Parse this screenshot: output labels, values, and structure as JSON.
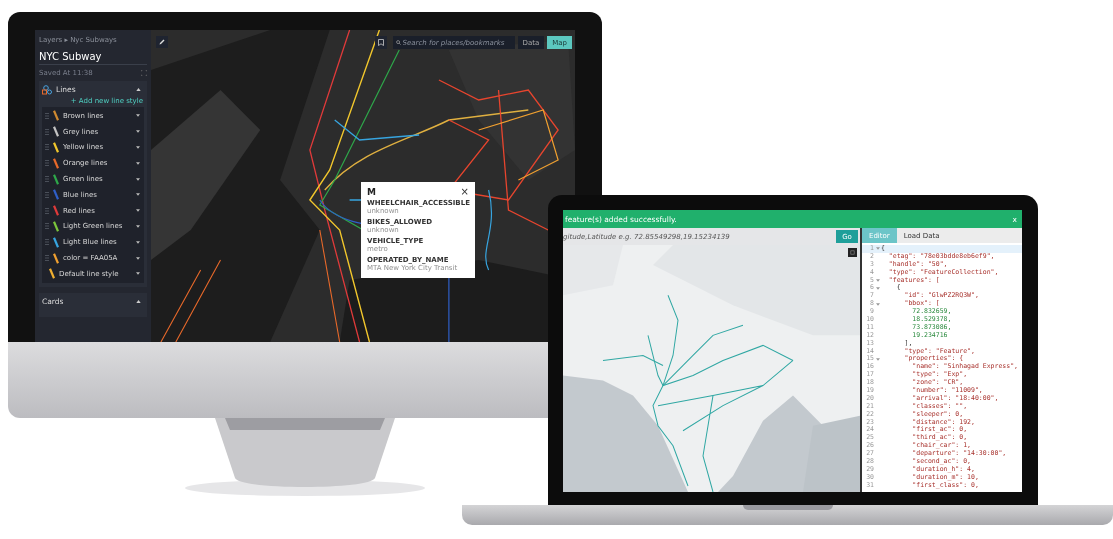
{
  "monitor": {
    "sidebar": {
      "breadcrumb": "Layers ▸ Nyc Subways",
      "title": "NYC Subway",
      "saved": "Saved At 11:38",
      "lines_panel": {
        "title": "Lines",
        "expanded": true,
        "add_label": "+ Add new line style",
        "items": [
          {
            "label": "Brown lines",
            "color": "#d08a30",
            "kind": "style"
          },
          {
            "label": "Grey lines",
            "color": "#c4c4c4",
            "kind": "style"
          },
          {
            "label": "Yellow lines",
            "color": "#f2c72c",
            "kind": "style"
          },
          {
            "label": "Orange lines",
            "color": "#e8692a",
            "kind": "style"
          },
          {
            "label": "Green lines",
            "color": "#2ea84a",
            "kind": "style"
          },
          {
            "label": "Blue lines",
            "color": "#2f5fc8",
            "kind": "style"
          },
          {
            "label": "Red lines",
            "color": "#e03a3a",
            "kind": "style"
          },
          {
            "label": "Light Green lines",
            "color": "#7cc63c",
            "kind": "style"
          },
          {
            "label": "Light Blue lines",
            "color": "#37a5e0",
            "kind": "style"
          },
          {
            "label": "color = FAA05A",
            "color": "#f0a030",
            "kind": "style"
          },
          {
            "label": "Default line style",
            "color": "#f0b030",
            "kind": "default"
          }
        ]
      },
      "cards_panel": {
        "title": "Cards",
        "expanded": true
      }
    },
    "map": {
      "search": {
        "placeholder": "Search for places/bookmarks"
      },
      "view_tabs": [
        {
          "label": "Data",
          "selected": false
        },
        {
          "label": "Map",
          "selected": true
        }
      ],
      "popup": {
        "title": "M",
        "close": "×",
        "properties": [
          {
            "key": "WHEELCHAIR_ACCESSIBLE",
            "value": "unknown"
          },
          {
            "key": "BIKES_ALLOWED",
            "value": "unknown"
          },
          {
            "key": "VEHICLE_TYPE",
            "value": "metro"
          },
          {
            "key": "OPERATED_BY_NAME",
            "value": "MTA New York City Transit"
          }
        ]
      }
    }
  },
  "laptop": {
    "notification": {
      "message": "feature(s) added successfully.",
      "close": "x"
    },
    "search": {
      "placeholder": "gitude,Latitude e.g. 72.85549298,19.15234139",
      "button": "Go"
    },
    "editor_tabs": [
      {
        "label": "Editor",
        "selected": true
      },
      {
        "label": "Load Data",
        "selected": false
      }
    ],
    "code_lines": [
      {
        "number": "1",
        "code": "{",
        "foldable": true,
        "active": true,
        "kind": "punct"
      },
      {
        "number": "2",
        "code": "  \"etag\": \"78e03bdde8eb6ef9\",",
        "foldable": false,
        "active": false,
        "kind": "string"
      },
      {
        "number": "3",
        "code": "  \"handle\": \"50\",",
        "foldable": false,
        "active": false,
        "kind": "string"
      },
      {
        "number": "4",
        "code": "  \"type\": \"FeatureCollection\",",
        "foldable": false,
        "active": false,
        "kind": "string"
      },
      {
        "number": "5",
        "code": "  \"features\": [",
        "foldable": true,
        "active": false,
        "kind": "string"
      },
      {
        "number": "6",
        "code": "    {",
        "foldable": true,
        "active": false,
        "kind": "punct"
      },
      {
        "number": "7",
        "code": "      \"id\": \"GlwPZ2RQ3W\",",
        "foldable": false,
        "active": false,
        "kind": "string"
      },
      {
        "number": "8",
        "code": "      \"bbox\": [",
        "foldable": true,
        "active": false,
        "kind": "string"
      },
      {
        "number": "9",
        "code": "        72.832659,",
        "foldable": false,
        "active": false,
        "kind": "number"
      },
      {
        "number": "10",
        "code": "        18.529378,",
        "foldable": false,
        "active": false,
        "kind": "number"
      },
      {
        "number": "11",
        "code": "        73.873086,",
        "foldable": false,
        "active": false,
        "kind": "number"
      },
      {
        "number": "12",
        "code": "        19.234716",
        "foldable": false,
        "active": false,
        "kind": "number"
      },
      {
        "number": "13",
        "code": "      ],",
        "foldable": false,
        "active": false,
        "kind": "punct"
      },
      {
        "number": "14",
        "code": "      \"type\": \"Feature\",",
        "foldable": false,
        "active": false,
        "kind": "string"
      },
      {
        "number": "15",
        "code": "      \"properties\": {",
        "foldable": true,
        "active": false,
        "kind": "string"
      },
      {
        "number": "16",
        "code": "        \"name\": \"Sinhagad Express\",",
        "foldable": false,
        "active": false,
        "kind": "string"
      },
      {
        "number": "17",
        "code": "        \"type\": \"Exp\",",
        "foldable": false,
        "active": false,
        "kind": "string"
      },
      {
        "number": "18",
        "code": "        \"zone\": \"CR\",",
        "foldable": false,
        "active": false,
        "kind": "string"
      },
      {
        "number": "19",
        "code": "        \"number\": \"11009\",",
        "foldable": false,
        "active": false,
        "kind": "string"
      },
      {
        "number": "20",
        "code": "        \"arrival\": \"18:40:00\",",
        "foldable": false,
        "active": false,
        "kind": "string"
      },
      {
        "number": "21",
        "code": "        \"classes\": \"\",",
        "foldable": false,
        "active": false,
        "kind": "string"
      },
      {
        "number": "22",
        "code": "        \"sleeper\": 0,",
        "foldable": false,
        "active": false,
        "kind": "string"
      },
      {
        "number": "23",
        "code": "        \"distance\": 192,",
        "foldable": false,
        "active": false,
        "kind": "string"
      },
      {
        "number": "24",
        "code": "        \"first_ac\": 0,",
        "foldable": false,
        "active": false,
        "kind": "string"
      },
      {
        "number": "25",
        "code": "        \"third_ac\": 0,",
        "foldable": false,
        "active": false,
        "kind": "string"
      },
      {
        "number": "26",
        "code": "        \"chair_car\": 1,",
        "foldable": false,
        "active": false,
        "kind": "string"
      },
      {
        "number": "27",
        "code": "        \"departure\": \"14:30:00\",",
        "foldable": false,
        "active": false,
        "kind": "string"
      },
      {
        "number": "28",
        "code": "        \"second_ac\": 0,",
        "foldable": false,
        "active": false,
        "kind": "string"
      },
      {
        "number": "29",
        "code": "        \"duration_h\": 4,",
        "foldable": false,
        "active": false,
        "kind": "string"
      },
      {
        "number": "30",
        "code": "        \"duration_m\": 10,",
        "foldable": false,
        "active": false,
        "kind": "string"
      },
      {
        "number": "31",
        "code": "        \"first_class\": 0,",
        "foldable": false,
        "active": false,
        "kind": "string"
      }
    ]
  }
}
